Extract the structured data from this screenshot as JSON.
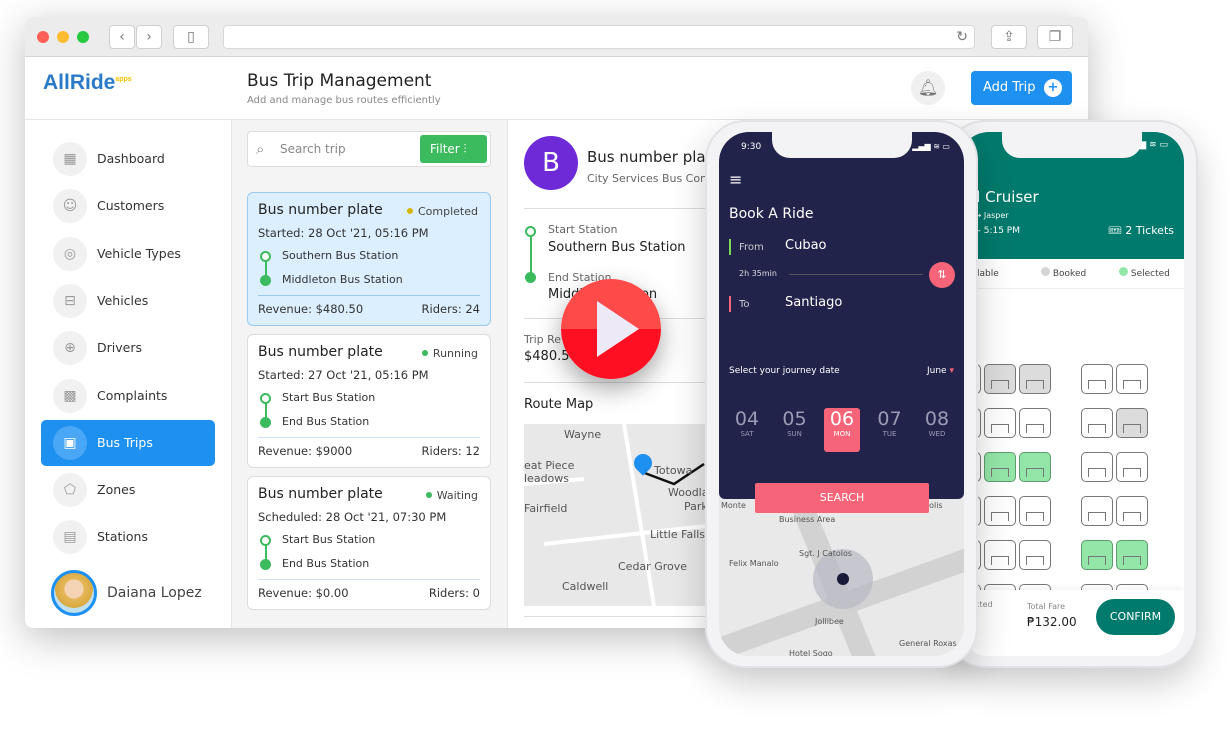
{
  "app": {
    "logo": "AllRide",
    "logo_suffix": "apps",
    "title": "Bus Trip Management",
    "subtitle": "Add and manage bus routes efficiently",
    "add_button": "Add Trip"
  },
  "sidebar": {
    "items": [
      {
        "label": "Dashboard",
        "icon": "grid-icon"
      },
      {
        "label": "Customers",
        "icon": "user-icon"
      },
      {
        "label": "Vehicle Types",
        "icon": "wheel-icon"
      },
      {
        "label": "Vehicles",
        "icon": "car-icon"
      },
      {
        "label": "Drivers",
        "icon": "steering-icon"
      },
      {
        "label": "Complaints",
        "icon": "qr-icon"
      },
      {
        "label": "Bus Trips",
        "icon": "bus-icon",
        "active": true
      },
      {
        "label": "Zones",
        "icon": "zone-icon"
      },
      {
        "label": "Stations",
        "icon": "station-icon"
      }
    ],
    "user": "Daiana Lopez"
  },
  "list": {
    "search_placeholder": "Search trip",
    "filter_label": "Filter",
    "trips": [
      {
        "title": "Bus number plate",
        "status": "Completed",
        "status_color": "#d6b400",
        "date": "Started: 28 Oct '21, 05:16 PM",
        "start": "Southern Bus Station",
        "end": "Middleton Bus Station",
        "revenue": "Revenue: $480.50",
        "riders": "Riders: 24"
      },
      {
        "title": "Bus number plate",
        "status": "Running",
        "status_color": "#3cba5e",
        "date": "Started: 27 Oct '21, 05:16 PM",
        "start": "Start Bus Station",
        "end": "End Bus Station",
        "revenue": "Revenue: $9000",
        "riders": "Riders: 12"
      },
      {
        "title": "Bus number plate",
        "status": "Waiting",
        "status_color": "#3cba5e",
        "date": "Scheduled: 28 Oct '21, 07:30 PM",
        "start": "Start Bus Station",
        "end": "End Bus Station",
        "revenue": "Revenue: $0.00",
        "riders": "Riders: 0"
      }
    ]
  },
  "detail": {
    "avatar_letter": "B",
    "title": "Bus number plat",
    "subtitle": "City Services Bus Con",
    "start_label": "Start Station",
    "start": "Southern Bus Station",
    "end_label": "End Station",
    "end": "Middl          ation",
    "revenue_label": "Trip Rev",
    "revenue": "$480.50",
    "route_map": "Route Map",
    "map_labels": [
      "Wayne",
      "Totowa",
      "eat Piece",
      "leadows",
      "Woodla",
      "Park",
      "Fairfield",
      "Little Falls",
      "Cedar Grove",
      "Caldwell"
    ]
  },
  "phone1": {
    "time": "9:30",
    "title": "Book A Ride",
    "from_label": "From",
    "from": "Cubao",
    "duration": "2h 35min",
    "to_label": "To",
    "to": "Santiago",
    "date_prompt": "Select your journey date",
    "month": "June",
    "days": [
      {
        "num": "04",
        "day": "SAT"
      },
      {
        "num": "05",
        "day": "SUN"
      },
      {
        "num": "06",
        "day": "MON",
        "selected": true
      },
      {
        "num": "07",
        "day": "TUE"
      },
      {
        "num": "08",
        "day": "WED"
      }
    ],
    "search": "SEARCH",
    "map_labels": [
      "Business Area",
      "Felix Manalo",
      "Sgt. J Catolos",
      "Jollibee",
      "Hotel Sogo",
      "General Roxas",
      "Monte",
      "polis"
    ]
  },
  "phone2": {
    "title": "al Cruiser",
    "route_from": "d",
    "route_to": "Jasper",
    "time": "M - 5:15 PM",
    "tickets": "2 Tickets",
    "legend": [
      "ailable",
      "Booked",
      "Selected"
    ],
    "selected_label": "elected",
    "fare_label": "Total Fare",
    "fare": "₱132.00",
    "confirm": "CONFIRM",
    "accent": "#007a6c"
  }
}
